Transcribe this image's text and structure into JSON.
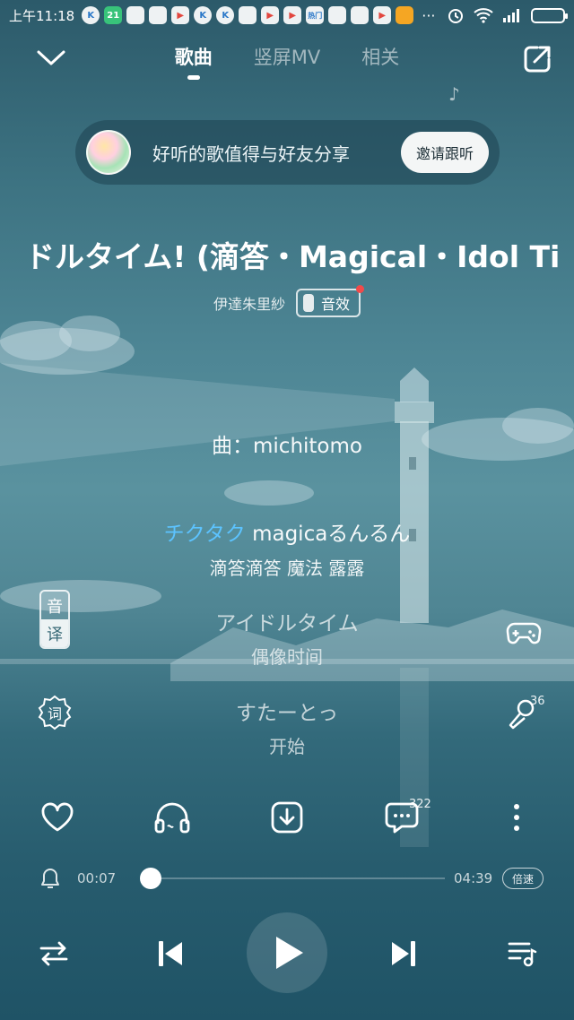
{
  "status_bar": {
    "time": "上午11:18",
    "notifications": [
      {
        "icon": "k-app-icon",
        "text": "K"
      },
      {
        "icon": "21-app-icon",
        "text": "21"
      },
      {
        "icon": "message-app-icon",
        "text": ""
      },
      {
        "icon": "message-app-icon",
        "text": ""
      },
      {
        "icon": "play-store-icon",
        "text": "▶"
      },
      {
        "icon": "k-app-icon",
        "text": "K"
      },
      {
        "icon": "k-app-icon",
        "text": "K"
      },
      {
        "icon": "message-app-icon",
        "text": ""
      },
      {
        "icon": "play-store-icon",
        "text": "▶"
      },
      {
        "icon": "play-store-icon",
        "text": "▶"
      },
      {
        "icon": "hot-app-icon",
        "text": "热门"
      },
      {
        "icon": "message-app-icon",
        "text": ""
      },
      {
        "icon": "message-app-icon",
        "text": ""
      },
      {
        "icon": "play-store-icon",
        "text": "▶"
      },
      {
        "icon": "mascot-app-icon",
        "text": ""
      }
    ],
    "more": "···"
  },
  "header": {
    "tabs": [
      {
        "label": "歌曲",
        "active": true
      },
      {
        "label": "竖屏MV",
        "active": false
      },
      {
        "label": "相关",
        "active": false
      }
    ]
  },
  "share_banner": {
    "text": "好听的歌值得与好友分享",
    "button": "邀请跟听"
  },
  "song": {
    "title": "ドルタイム! (滴答・Magical・Idol Ti",
    "artist": "伊達朱里紗",
    "effect_label": "音效"
  },
  "lyrics": {
    "composer": "曲：michitomo",
    "lines": [
      {
        "sung": "チクタク",
        "rest": " magicaるんるん",
        "translation": "滴答滴答 魔法 露露"
      },
      {
        "sung": "",
        "rest": "アイドルタイム",
        "translation": "偶像时间"
      },
      {
        "sung": "",
        "rest": "すたーとっ",
        "translation": "开始"
      }
    ]
  },
  "side": {
    "yin": "音",
    "yi": "译",
    "ci": "词",
    "karaoke_count": "36"
  },
  "actions": {
    "comment_count": "322"
  },
  "progress": {
    "current": "00:07",
    "total": "04:39",
    "fraction": 0.025,
    "speed_label": "倍速"
  }
}
